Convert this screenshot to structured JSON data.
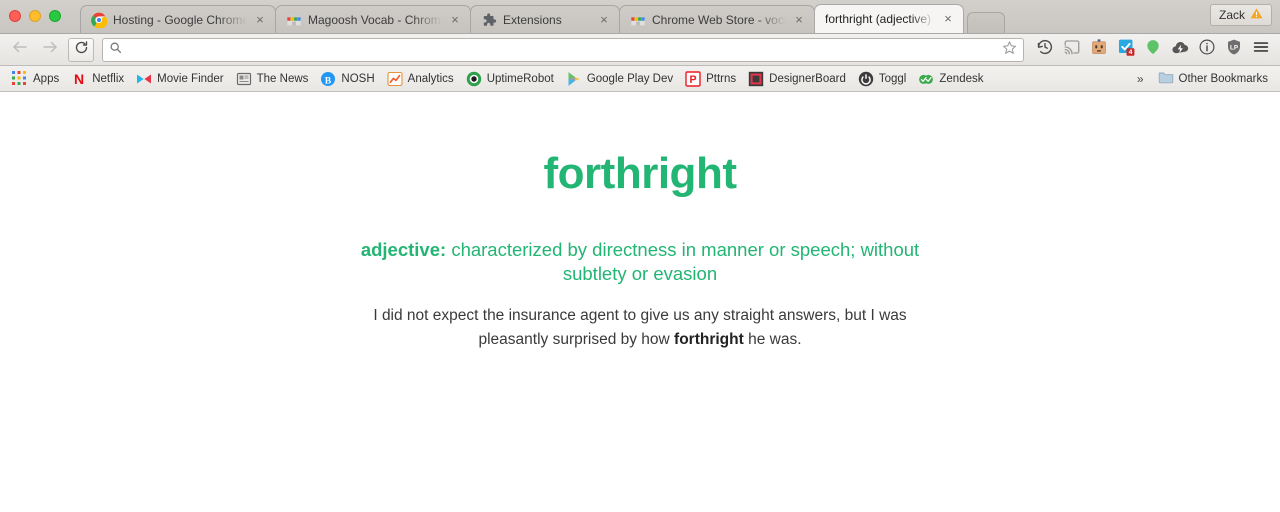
{
  "window": {
    "traffic_lights": [
      "close",
      "minimize",
      "zoom"
    ],
    "profile": {
      "name": "Zack",
      "warning_icon": "warning-triangle-icon"
    }
  },
  "tabs": [
    {
      "title": "Hosting - Google Chrome",
      "favicon": "chrome-logo-icon",
      "active": false,
      "close_label": "×"
    },
    {
      "title": "Magoosh Vocab - Chrome",
      "favicon": "chrome-webstore-icon",
      "active": false,
      "close_label": "×"
    },
    {
      "title": "Extensions",
      "favicon": "puzzle-piece-icon",
      "active": false,
      "close_label": "×"
    },
    {
      "title": "Chrome Web Store - vocab",
      "favicon": "chrome-webstore-icon",
      "active": false,
      "close_label": "×"
    },
    {
      "title": "forthright (adjective)",
      "favicon": "none",
      "active": true,
      "close_label": "×"
    }
  ],
  "toolbar": {
    "back_icon": "back-arrow-icon",
    "forward_icon": "forward-arrow-icon",
    "reload_icon": "reload-icon",
    "search_icon": "search-icon",
    "omnibox_value": "",
    "omnibox_placeholder": "",
    "bookmark_star_icon": "star-icon",
    "menu_icon": "hamburger-menu-icon",
    "extensions": [
      {
        "name": "history-clock-icon",
        "badge": ""
      },
      {
        "name": "cast-icon",
        "badge": ""
      },
      {
        "name": "robot-icon",
        "badge": ""
      },
      {
        "name": "checkbox-icon",
        "badge": "4"
      },
      {
        "name": "location-pin-icon",
        "badge": ""
      },
      {
        "name": "cloud-bolt-icon",
        "badge": ""
      },
      {
        "name": "info-circle-icon",
        "badge": ""
      },
      {
        "name": "shield-lastpass-icon",
        "badge": ""
      }
    ]
  },
  "bookmarks": {
    "items": [
      {
        "label": "Apps",
        "icon": "apps-grid-icon"
      },
      {
        "label": "Netflix",
        "icon": "netflix-icon"
      },
      {
        "label": "Movie Finder",
        "icon": "movie-finder-icon"
      },
      {
        "label": "The News",
        "icon": "news-icon"
      },
      {
        "label": "NOSH",
        "icon": "nosh-icon"
      },
      {
        "label": "Analytics",
        "icon": "analytics-icon"
      },
      {
        "label": "UptimeRobot",
        "icon": "uptimerobot-icon"
      },
      {
        "label": "Google Play Dev",
        "icon": "google-play-icon"
      },
      {
        "label": "Pttrns",
        "icon": "pttrns-icon"
      },
      {
        "label": "DesignerBoard",
        "icon": "designerboard-icon"
      },
      {
        "label": "Toggl",
        "icon": "toggl-icon"
      },
      {
        "label": "Zendesk",
        "icon": "zendesk-icon"
      }
    ],
    "overflow_label": "»",
    "other_bookmarks": {
      "label": "Other Bookmarks",
      "icon": "folder-icon"
    }
  },
  "page": {
    "word": "forthright",
    "part_of_speech": "adjective:",
    "definition": "characterized by directness in manner or speech; without subtlety or evasion",
    "example_prefix": "I did not expect the insurance agent to give us any straight answers, but I was pleasantly surprised by how ",
    "example_highlight": "forthright",
    "example_suffix": " he was.",
    "accent_color": "#22b573",
    "text_color": "#3a3a3a"
  }
}
